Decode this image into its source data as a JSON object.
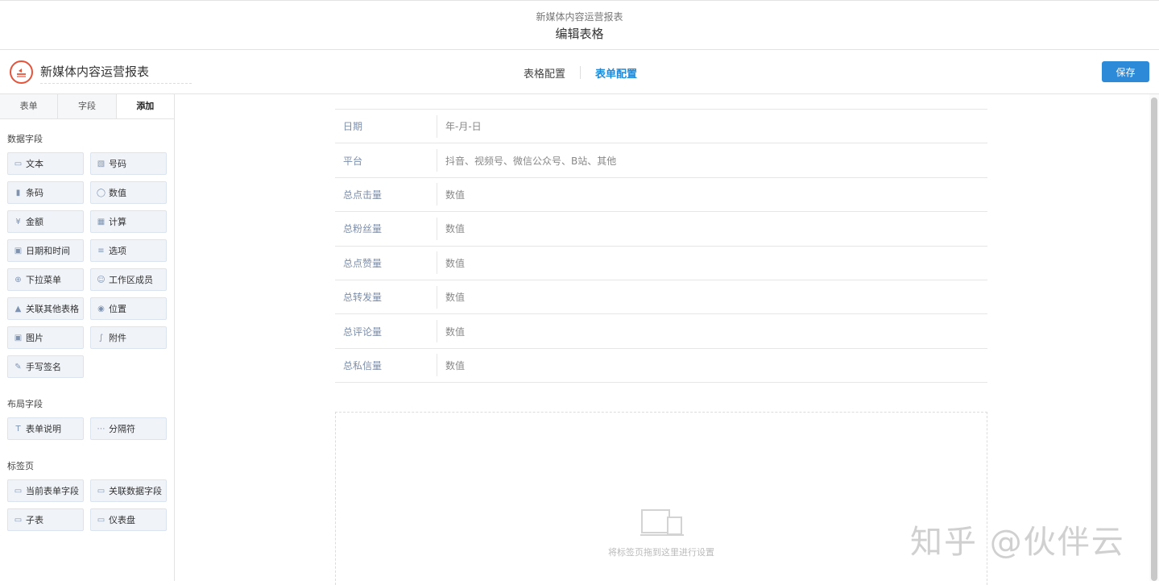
{
  "window": {
    "subtitle": "新媒体内容运营报表",
    "title": "编辑表格"
  },
  "header": {
    "form_title": "新媒体内容运营报表",
    "tabs": [
      {
        "label": "表格配置",
        "active": false
      },
      {
        "label": "表单配置",
        "active": true
      }
    ],
    "save_label": "保存"
  },
  "sidebar": {
    "tabs": [
      "表单",
      "字段",
      "添加"
    ],
    "sections": [
      {
        "title": "数据字段",
        "items": [
          {
            "label": "文本",
            "icon": "text-icon"
          },
          {
            "label": "号码",
            "icon": "number-icon"
          },
          {
            "label": "条码",
            "icon": "barcode-icon"
          },
          {
            "label": "数值",
            "icon": "numeric-icon"
          },
          {
            "label": "金额",
            "icon": "currency-icon"
          },
          {
            "label": "计算",
            "icon": "calculator-icon"
          },
          {
            "label": "日期和时间",
            "icon": "calendar-icon"
          },
          {
            "label": "选项",
            "icon": "list-icon"
          },
          {
            "label": "下拉菜单",
            "icon": "dropdown-icon"
          },
          {
            "label": "工作区成员",
            "icon": "member-icon"
          },
          {
            "label": "关联其他表格",
            "icon": "relation-icon"
          },
          {
            "label": "位置",
            "icon": "location-icon"
          },
          {
            "label": "图片",
            "icon": "image-icon"
          },
          {
            "label": "附件",
            "icon": "paperclip-icon"
          },
          {
            "label": "手写签名",
            "icon": "pen-icon"
          }
        ]
      },
      {
        "title": "布局字段",
        "items": [
          {
            "label": "表单说明",
            "icon": "text-t-icon"
          },
          {
            "label": "分隔符",
            "icon": "ellipsis-icon"
          }
        ]
      },
      {
        "title": "标签页",
        "items": [
          {
            "label": "当前表单字段",
            "icon": "tab-icon"
          },
          {
            "label": "关联数据字段",
            "icon": "tab-icon"
          },
          {
            "label": "子表",
            "icon": "tab-icon"
          },
          {
            "label": "仪表盘",
            "icon": "tab-icon"
          }
        ]
      }
    ]
  },
  "form_rows": [
    {
      "label": "日期",
      "value": "年-月-日"
    },
    {
      "label": "平台",
      "value": "抖音、视频号、微信公众号、B站、其他"
    },
    {
      "label": "总点击量",
      "value": "数值"
    },
    {
      "label": "总粉丝量",
      "value": "数值"
    },
    {
      "label": "总点赞量",
      "value": "数值"
    },
    {
      "label": "总转发量",
      "value": "数值"
    },
    {
      "label": "总评论量",
      "value": "数值"
    },
    {
      "label": "总私信量",
      "value": "数值"
    }
  ],
  "dropzone": {
    "hint": "将标签页拖到这里进行设置",
    "icon": "devices-icon"
  },
  "watermark": "知乎 @伙伴云",
  "colors": {
    "accent": "#2d8ad9",
    "logo": "#e6533a",
    "label": "#7c8eaa"
  }
}
